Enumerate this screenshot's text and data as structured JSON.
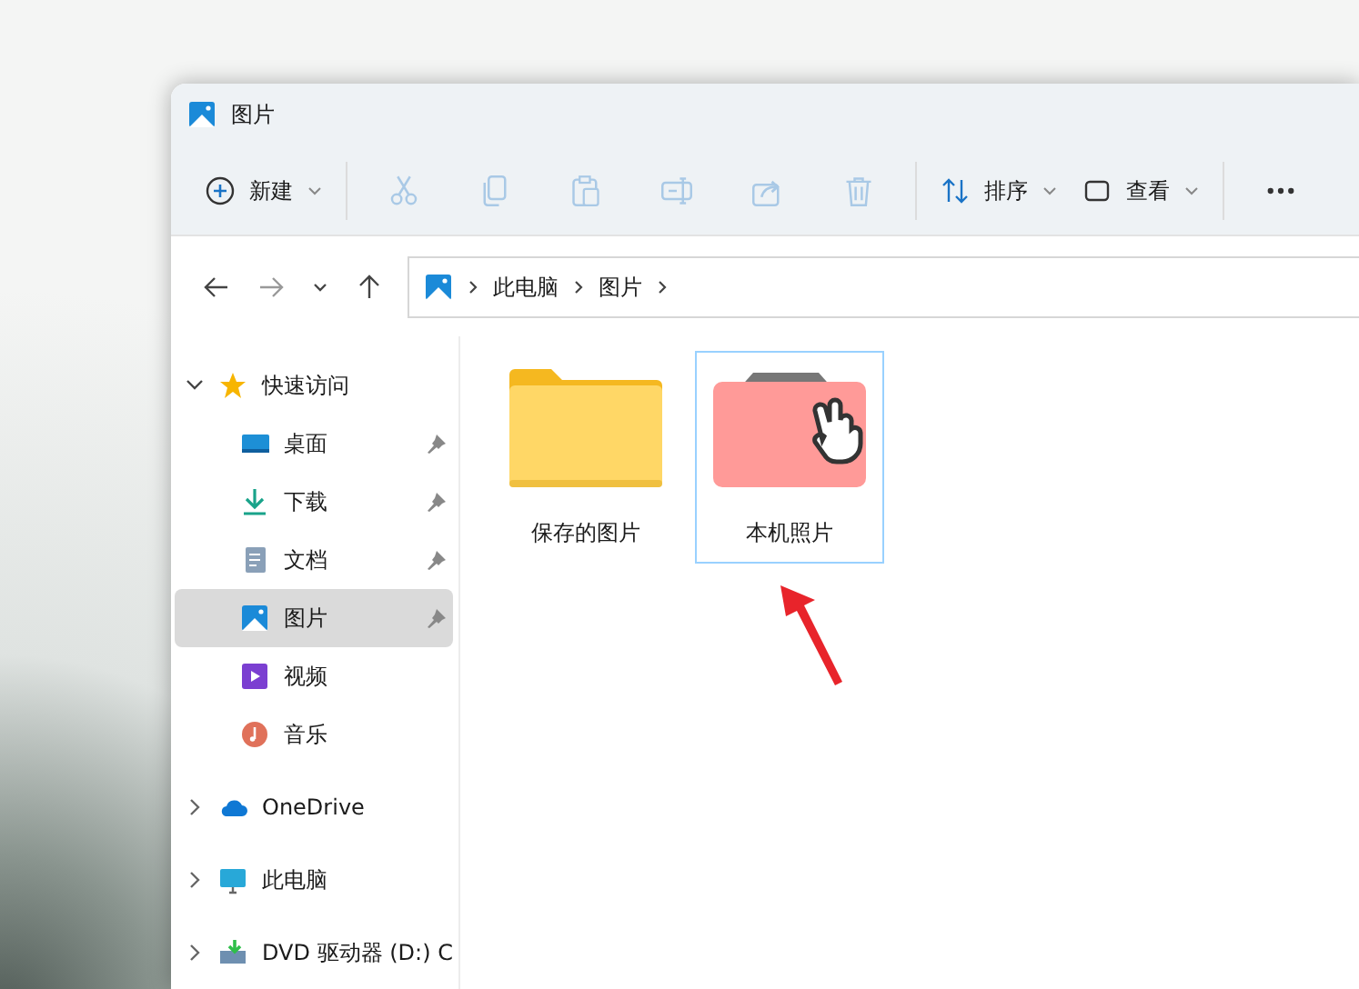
{
  "window": {
    "title": "图片"
  },
  "toolbar": [
    {
      "kind": "new",
      "label": "新建",
      "disabled": false
    },
    {
      "kind": "cut",
      "disabled": true
    },
    {
      "kind": "copy",
      "disabled": true
    },
    {
      "kind": "paste",
      "disabled": true
    },
    {
      "kind": "rename",
      "disabled": true
    },
    {
      "kind": "share",
      "disabled": true
    },
    {
      "kind": "delete",
      "disabled": true
    },
    {
      "kind": "sort",
      "label": "排序",
      "disabled": false
    },
    {
      "kind": "view",
      "label": "查看",
      "disabled": false
    },
    {
      "kind": "more",
      "disabled": false
    }
  ],
  "navigation": {
    "back_disabled": false,
    "forward_disabled": true
  },
  "address": {
    "crumbs": [
      "此电脑",
      "图片"
    ]
  },
  "sidebar": {
    "items": [
      {
        "kind": "star",
        "label": "快速访问",
        "expanded": true,
        "selected": false,
        "children": [
          {
            "kind": "desktop",
            "label": "桌面",
            "pinned": true,
            "selected": false
          },
          {
            "kind": "download",
            "label": "下载",
            "pinned": true,
            "selected": false
          },
          {
            "kind": "document",
            "label": "文档",
            "pinned": true,
            "selected": false
          },
          {
            "kind": "picture",
            "label": "图片",
            "pinned": true,
            "selected": true
          },
          {
            "kind": "video",
            "label": "视频",
            "pinned": false,
            "selected": false
          },
          {
            "kind": "music",
            "label": "音乐",
            "pinned": false,
            "selected": false
          }
        ]
      },
      {
        "kind": "cloud",
        "label": "OneDrive",
        "expanded": false,
        "selected": false
      },
      {
        "kind": "computer",
        "label": "此电脑",
        "expanded": false,
        "selected": false
      },
      {
        "kind": "dvd",
        "label": "DVD 驱动器 (D:) C",
        "expanded": false,
        "selected": false
      }
    ]
  },
  "folders": [
    {
      "kind": "folder",
      "label": "保存的图片",
      "selected": false
    },
    {
      "kind": "camera-roll",
      "label": "本机照片",
      "selected": true
    }
  ]
}
